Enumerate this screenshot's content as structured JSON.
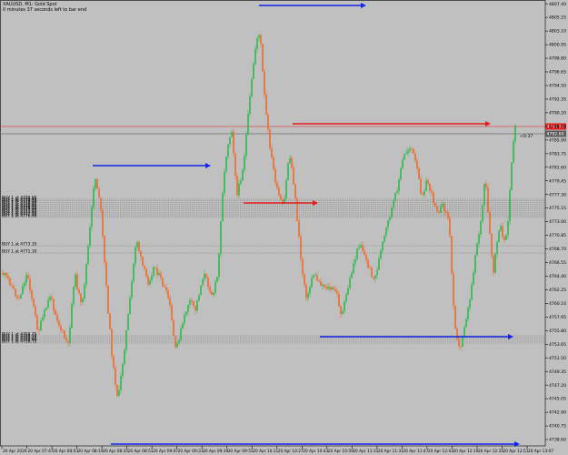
{
  "symbol_line": "XAUUSD, M1: Gold Spot",
  "countdown_line": "0 minutes 37 seconds left to bar end",
  "price_axis": [
    "4807.40",
    "4805.25",
    "4803.10",
    "4800.95",
    "4798.80",
    "4796.65",
    "4794.50",
    "4792.35",
    "4790.20",
    "4788.05",
    "4785.90",
    "4783.75",
    "4781.60",
    "4779.45",
    "4777.30",
    "4775.15",
    "4773.00",
    "4770.85",
    "4768.70",
    "4766.55",
    "4764.40",
    "4762.25",
    "4760.10",
    "4757.95",
    "4755.80",
    "4753.65",
    "4751.50",
    "4749.35",
    "4747.20",
    "4745.05",
    "4742.90",
    "4740.75",
    "4738.60"
  ],
  "time_axis": [
    "20 Apr 2026",
    "20 Apr 07:47",
    "20 Apr 08:03",
    "20 Apr 08:19",
    "20 Apr 08:35",
    "20 Apr 08:51",
    "20 Apr 09:07",
    "20 Apr 09:23",
    "20 Apr 09:39",
    "20 Apr 09:55",
    "20 Apr 10:11",
    "20 Apr 10:27",
    "20 Apr 10:43",
    "20 Apr 10:59",
    "20 Apr 11:15",
    "20 Apr 11:31",
    "20 Apr 11:47",
    "20 Apr 12:03",
    "20 Apr 12:19",
    "20 Apr 12:35",
    "20 Apr 12:51",
    "20 Apr 13:07"
  ],
  "price_tags": {
    "red_level": "4793.52",
    "current": "4792.60"
  },
  "countdown_tag": "<0:37",
  "order_labels": {
    "upper_group": [
      "BUY 1 at 4779.65",
      "BUY 1 at 4779.40",
      "BUY 1 at 4779.15",
      "BUY 1 at 4778.90",
      "BUY 1 at 4778.65",
      "BUY 1 at 4778.40",
      "BUY 1 at 4778.15",
      "BUY 1 at 4777.90",
      "BUY 1 at 4777.65",
      "BUY 1 at 4777.40",
      "BUY 1 at 4777.15",
      "BUY 1 at 4776.90"
    ],
    "middle_group": [
      "BUY 1 at 4773.35",
      "BUY 1 at 4771.30"
    ],
    "lower_group": [
      "BUY 1 at 4759.75",
      "BUY 1 at 4759.50",
      "BUY 1 at 4759.25",
      "BUY 1 at 4759.00",
      "BUY 1 at 4758.75"
    ]
  },
  "colors": {
    "background": "#c0c0c0",
    "bull": "#2db84c",
    "bear": "#ee6a2a",
    "resistance_arrow": "#e21b1b",
    "support_arrow": "#1224e8",
    "price_line": "#e21b1b",
    "bid_line": "#707070"
  }
}
